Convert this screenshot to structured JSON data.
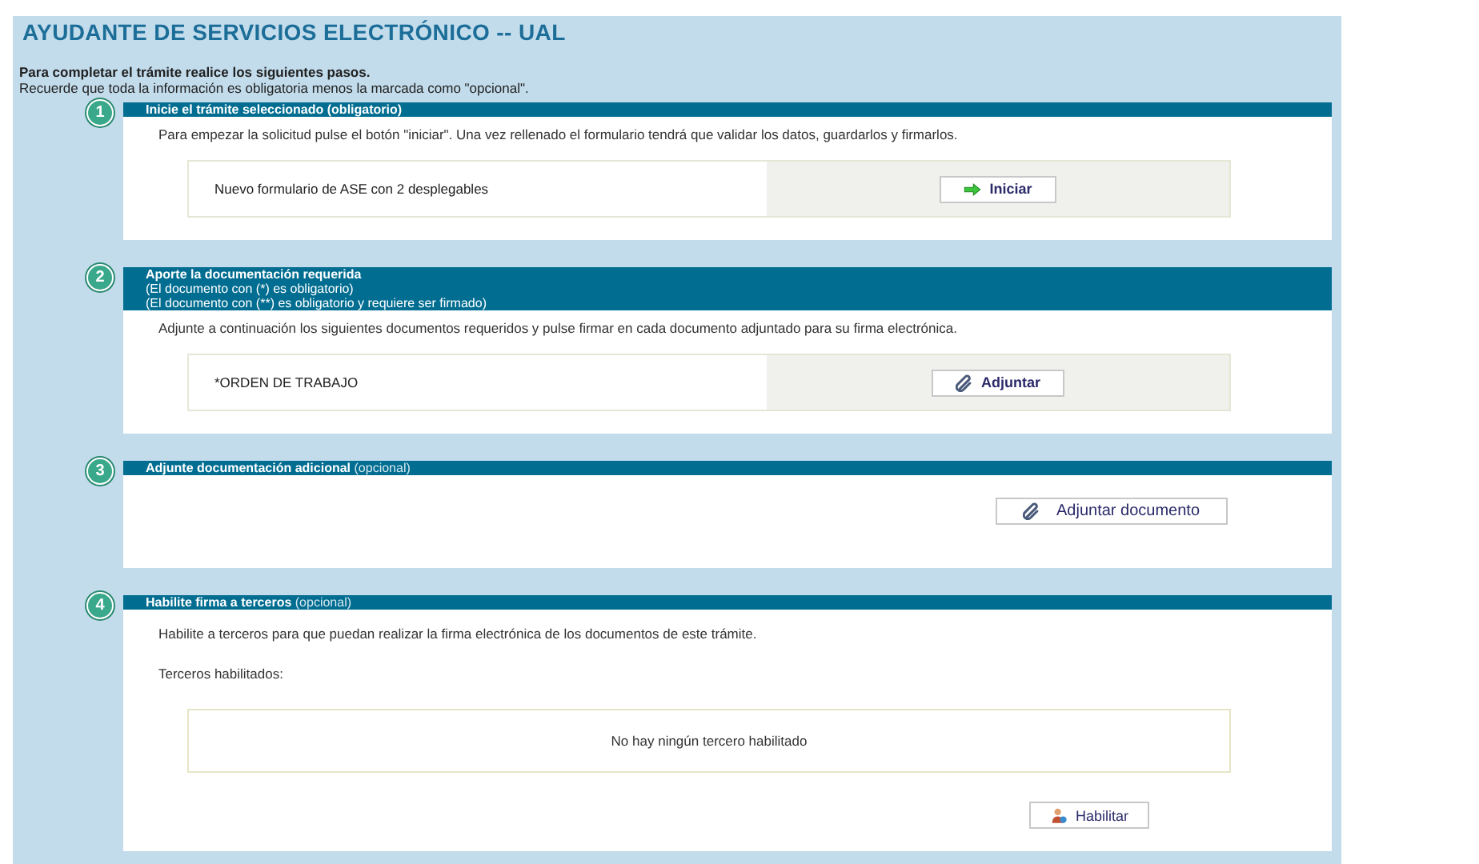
{
  "title": "AYUDANTE DE SERVICIOS ELECTRÓNICO -- UAL",
  "intro": [
    "Para completar el trámite realice los siguientes pasos.",
    "Recuerde que toda la información es obligatoria menos la marcada como \"opcional\"."
  ],
  "steps": [
    {
      "number": "1",
      "header": {
        "title": "Inicie el trámite seleccionado (obligatorio)"
      },
      "blocks": [
        {
          "kind": "text",
          "text": "Para empezar la solicitud pulse el botón \"iniciar\". Una vez rellenado el formulario tendrá que validar los datos, guardarlos y firmarlos."
        },
        {
          "kind": "row",
          "label": "Nuevo formulario de ASE con 2 desplegables",
          "button": {
            "kind": "start",
            "label": "Iniciar"
          }
        }
      ]
    },
    {
      "number": "2",
      "header": {
        "title": "Aporte la documentación requerida",
        "lines": [
          "(El documento con (*) es obligatorio)",
          "(El documento con (**) es obligatorio y requiere ser firmado)"
        ]
      },
      "blocks": [
        {
          "kind": "text",
          "text": "Adjunte a continuación los siguientes documentos requeridos y pulse firmar en cada documento adjuntado para su firma electrónica."
        },
        {
          "kind": "row",
          "label": "*ORDEN DE TRABAJO",
          "button": {
            "kind": "attach",
            "label": "Adjuntar"
          }
        }
      ]
    },
    {
      "number": "3",
      "header": {
        "title": "Adjunte documentación adicional",
        "note": "(opcional)"
      },
      "blocks": [
        {
          "kind": "button",
          "button": {
            "kind": "add",
            "label": "Adjuntar documento"
          }
        }
      ]
    },
    {
      "number": "4",
      "header": {
        "title": "Habilite firma a terceros",
        "note": "(opcional)"
      },
      "blocks": [
        {
          "kind": "text",
          "text": "Habilite a terceros para que puedan realizar la firma electrónica de los documentos de este trámite."
        },
        {
          "kind": "text",
          "text": "Terceros habilitados:"
        },
        {
          "kind": "box",
          "text": "No hay ningún tercero habilitado"
        },
        {
          "kind": "button",
          "button": {
            "kind": "enable",
            "label": "Habilitar"
          }
        }
      ]
    }
  ]
}
